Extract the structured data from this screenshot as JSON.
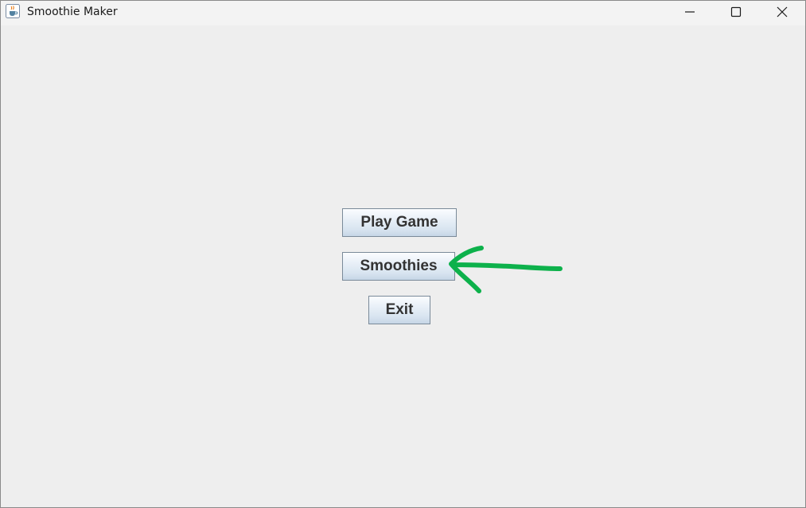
{
  "window": {
    "title": "Smoothie Maker",
    "app_icon": "java-cup-icon",
    "controls": {
      "minimize_icon": "minimize-icon",
      "maximize_icon": "maximize-icon",
      "close_icon": "close-icon"
    }
  },
  "menu": {
    "buttons": [
      {
        "label": "Play Game"
      },
      {
        "label": "Smoothies"
      },
      {
        "label": "Exit"
      }
    ]
  },
  "annotation": {
    "icon": "arrow-left-icon",
    "color": "#0db14b",
    "points_to": "Smoothies"
  }
}
